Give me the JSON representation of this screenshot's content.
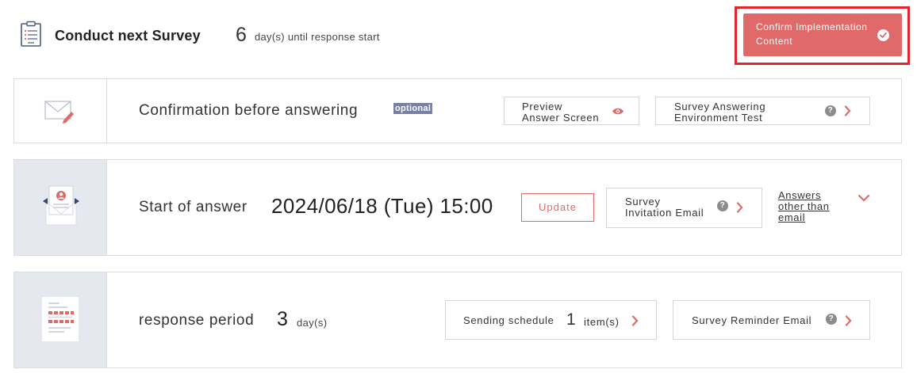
{
  "header": {
    "title": "Conduct next Survey",
    "days_count": "6",
    "days_text": "day(s) until response start",
    "confirm_line1": "Confirm Implementation",
    "confirm_line2": "Content"
  },
  "confirmation": {
    "title": "Confirmation before answering",
    "badge": "optional",
    "preview_line1": "Preview",
    "preview_line2": "Answer Screen",
    "env_line1": "Survey Answering",
    "env_line2": "Environment Test",
    "help_glyph": "?"
  },
  "start": {
    "title": "Start of answer",
    "date": "2024/06/18 (Tue) 15:00",
    "update_label": "Update",
    "invite_line1": "Survey",
    "invite_line2": "Invitation Email",
    "help_glyph": "?",
    "answers_line1": "Answers",
    "answers_line2": "other than",
    "answers_line3": "email"
  },
  "period": {
    "title": "response period",
    "days_count": "3",
    "days_unit": "day(s)",
    "schedule_label": "Sending schedule",
    "schedule_count": "1",
    "schedule_unit": "item(s)",
    "reminder_label": "Survey Reminder Email",
    "help_glyph": "?"
  },
  "colors": {
    "accent": "#e06a6a",
    "highlight_frame": "#e2262f",
    "badge": "#7980a6",
    "side_panel": "#e5e8ef",
    "border": "#dcdde1"
  },
  "icons": [
    "survey-document-icon",
    "check-circle-icon",
    "envelope-pen-icon",
    "eye-icon",
    "help-icon",
    "chevron-right-icon",
    "email-invite-icon",
    "chevron-down-icon",
    "schedule-document-icon"
  ]
}
